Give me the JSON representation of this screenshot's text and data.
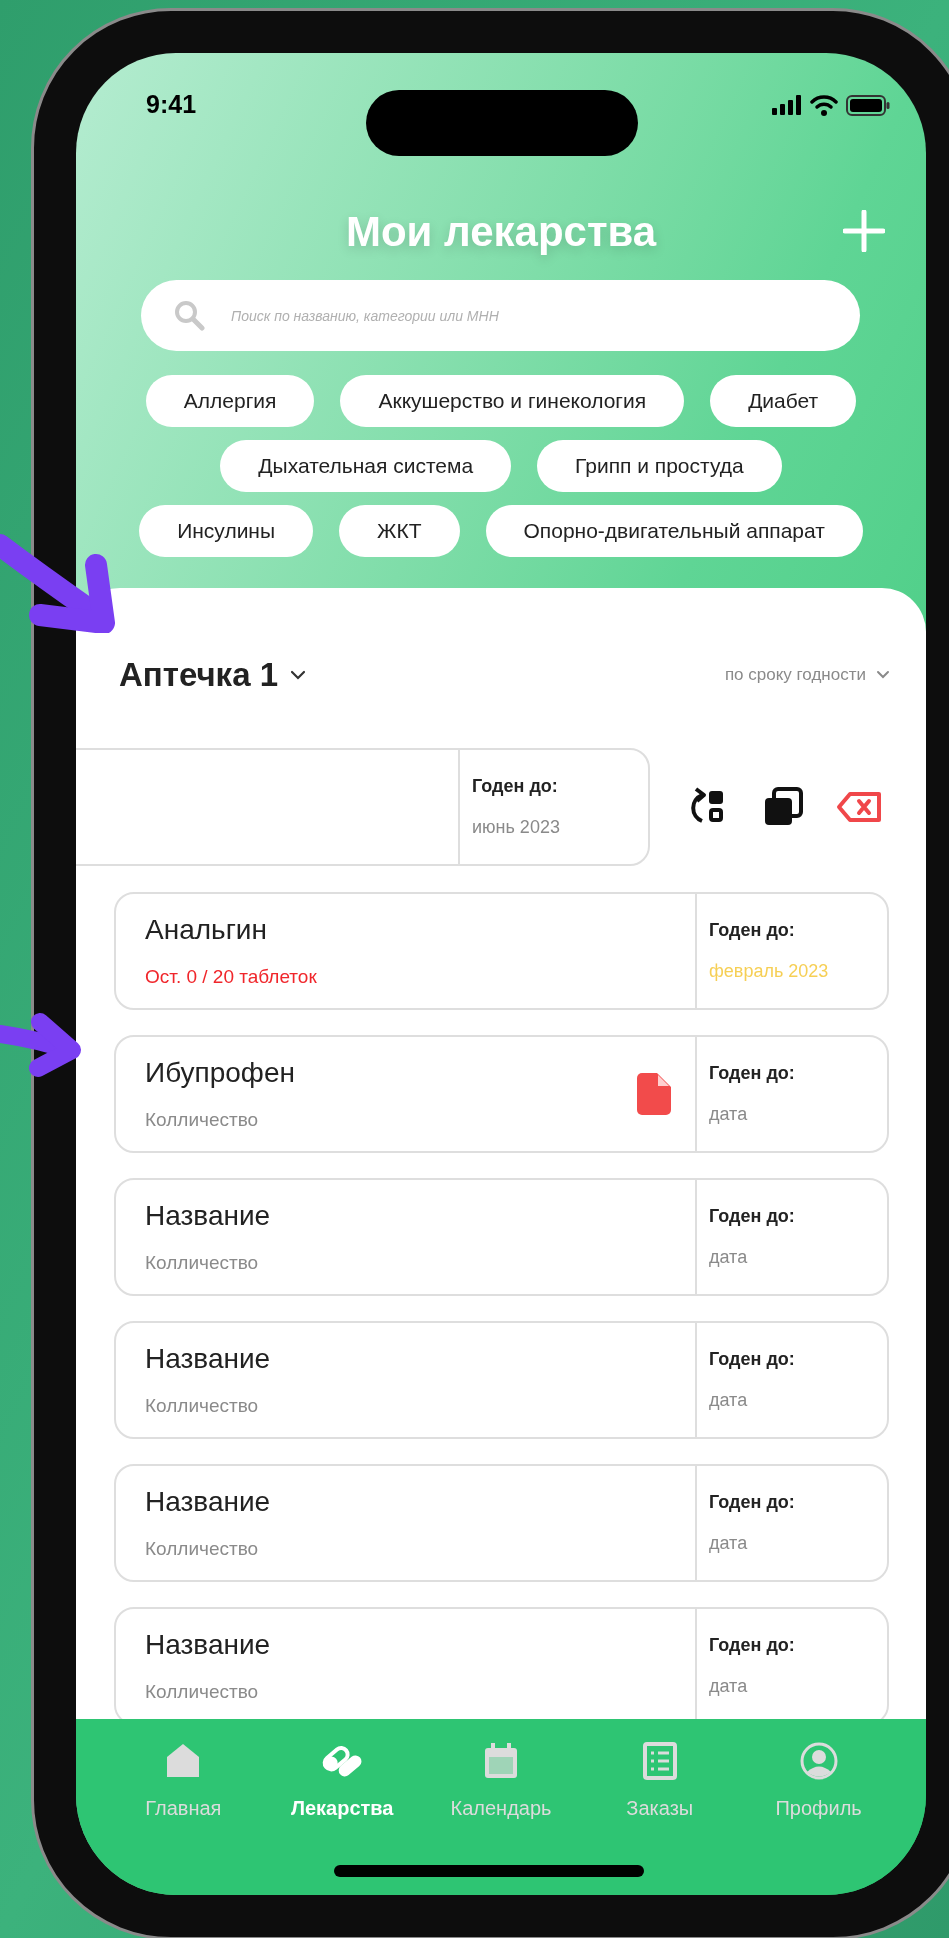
{
  "status_bar": {
    "time": "9:41"
  },
  "header": {
    "title": "Мои лекарства"
  },
  "search": {
    "placeholder": "Поиск по названию, категории или МНН"
  },
  "category_rows": [
    [
      "Аллергия",
      "Аккушерство и гинекология",
      "Диабет"
    ],
    [
      "Дыхательная система",
      "Грипп и простуда"
    ],
    [
      "Инсулины",
      "ЖКТ",
      "Опорно-двигательный аппарат"
    ]
  ],
  "kit": {
    "title": "Аптечка 1",
    "sort": "по сроку годности"
  },
  "swiped_item": {
    "expiry_label": "Годен до:",
    "expiry": "июнь 2023"
  },
  "medicines": [
    {
      "name": "Анальгин",
      "quantity": "Ост. 0 / 20 таблеток",
      "quantity_alert": true,
      "expiry_label": "Годен до:",
      "expiry": "февраль 2023",
      "expiry_warning": true,
      "has_document": false
    },
    {
      "name": "Ибупрофен",
      "quantity": "Колличество",
      "quantity_alert": false,
      "expiry_label": "Годен до:",
      "expiry": "дата",
      "expiry_warning": false,
      "has_document": true
    },
    {
      "name": "Название",
      "quantity": "Колличество",
      "quantity_alert": false,
      "expiry_label": "Годен до:",
      "expiry": "дата",
      "expiry_warning": false,
      "has_document": false
    },
    {
      "name": "Название",
      "quantity": "Колличество",
      "quantity_alert": false,
      "expiry_label": "Годен до:",
      "expiry": "дата",
      "expiry_warning": false,
      "has_document": false
    },
    {
      "name": "Название",
      "quantity": "Колличество",
      "quantity_alert": false,
      "expiry_label": "Годен до:",
      "expiry": "дата",
      "expiry_warning": false,
      "has_document": false
    },
    {
      "name": "Название",
      "quantity": "Колличество",
      "quantity_alert": false,
      "expiry_label": "Годен до:",
      "expiry": "дата",
      "expiry_warning": false,
      "has_document": false
    }
  ],
  "tab_bar": [
    {
      "kind": "home",
      "label": "Главная",
      "selected": false
    },
    {
      "kind": "pills",
      "label": "Лекарства",
      "selected": true
    },
    {
      "kind": "calendar",
      "label": "Календарь",
      "selected": false
    },
    {
      "kind": "orders",
      "label": "Заказы",
      "selected": false
    },
    {
      "kind": "profile",
      "label": "Профиль",
      "selected": false
    }
  ]
}
